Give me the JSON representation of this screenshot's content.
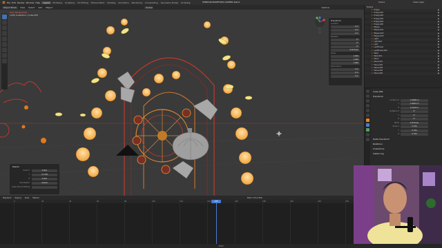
{
  "app": {
    "file_title": "WINDOW-MAKEFILES-CAMERA.blend",
    "menu": [
      "File",
      "Edit",
      "Render",
      "Window",
      "Help"
    ],
    "workspaces": [
      "Layout",
      "Modeling",
      "Sculpting",
      "UV Editing",
      "Texture Paint",
      "Shading",
      "Animation",
      "Rendering",
      "Compositing",
      "Geometry Nodes",
      "Scripting"
    ],
    "active_workspace": "Layout",
    "scene": "Scene",
    "view_layer": "View Layer"
  },
  "viewport_header": {
    "mode": "Object Mode",
    "items": [
      "View",
      "Select",
      "Add",
      "Object"
    ],
    "transform": "Global",
    "options": "Options"
  },
  "viewport": {
    "view_name": "User Perspective",
    "collection_line": "(145) Collection | Cube.003"
  },
  "n_panel": {
    "title": "Transform",
    "location_label": "Location",
    "location": [
      "0 m",
      "0 m",
      "0 m"
    ],
    "rotation_label": "Rotation",
    "rotation": [
      "0°",
      "0°",
      "0°"
    ],
    "mode": "XYZ Euler",
    "scale_label": "Scale",
    "scale": [
      "1.000",
      "1.000",
      "1.000"
    ],
    "dimensions_label": "Dimensions",
    "dimensions": [
      "0 m",
      "0 m",
      "0 m"
    ]
  },
  "redo_panel": {
    "title": "Resize",
    "rows": [
      {
        "k": "Scale X",
        "v": "0.941"
      },
      {
        "k": "Y",
        "v": "0.7748"
      },
      {
        "k": "Z",
        "v": "0.941"
      },
      {
        "k": "Orientation",
        "v": "Global"
      },
      {
        "k": "Proportional Editing",
        "v": ""
      }
    ]
  },
  "outliner": {
    "header": "Scene",
    "rows": [
      "Empty",
      "Empty.001",
      "Empty.002",
      "Empty.003",
      "Empty.004",
      "Empty.005",
      "Ellipse",
      "Ellipse.001",
      "Ellipse.002",
      "Ellipse.003",
      "Light",
      "Light.001",
      "Leaf",
      "LeafFlower",
      "LeafFlower.001",
      "Petal",
      "Petal.001",
      "Plane",
      "Plane.001",
      "Plane.002",
      "Plane.003",
      "Plane.004",
      "Plane.005"
    ]
  },
  "properties": {
    "object_name": "Cube.006",
    "sections": [
      {
        "title": "Transform",
        "rows": [
          {
            "k": "Location X",
            "v": "-0.5899 m"
          },
          {
            "k": "Y",
            "v": "-0.6816 m"
          },
          {
            "k": "Z",
            "v": "0.4418 m"
          },
          {
            "k": "Rotation X",
            "v": "0°"
          },
          {
            "k": "Y",
            "v": "0°"
          },
          {
            "k": "Z",
            "v": "0°"
          },
          {
            "k": "Mode",
            "v": "XYZ Euler"
          },
          {
            "k": "Scale X",
            "v": "0.784"
          },
          {
            "k": "Y",
            "v": "0.784"
          },
          {
            "k": "Z",
            "v": "0.784"
          }
        ]
      },
      {
        "title": "Delta Transform",
        "rows": []
      },
      {
        "title": "Relations",
        "rows": []
      },
      {
        "title": "Collections",
        "rows": []
      },
      {
        "title": "Instancing",
        "rows": []
      }
    ]
  },
  "timeline": {
    "menu": [
      "Playback",
      "Keying",
      "View",
      "Marker"
    ],
    "current_frame": "145",
    "ticks": [
      "0",
      "20",
      "40",
      "60",
      "80",
      "100",
      "120",
      "140",
      "160",
      "180",
      "200",
      "220",
      "240"
    ],
    "start_end": "Start 1  End 250"
  },
  "statusbar": {
    "text": "3.6.2"
  },
  "colors": {
    "accent": "#4772b3",
    "orange": "#e0862c",
    "viewport_bg": "#3a3a3a"
  }
}
